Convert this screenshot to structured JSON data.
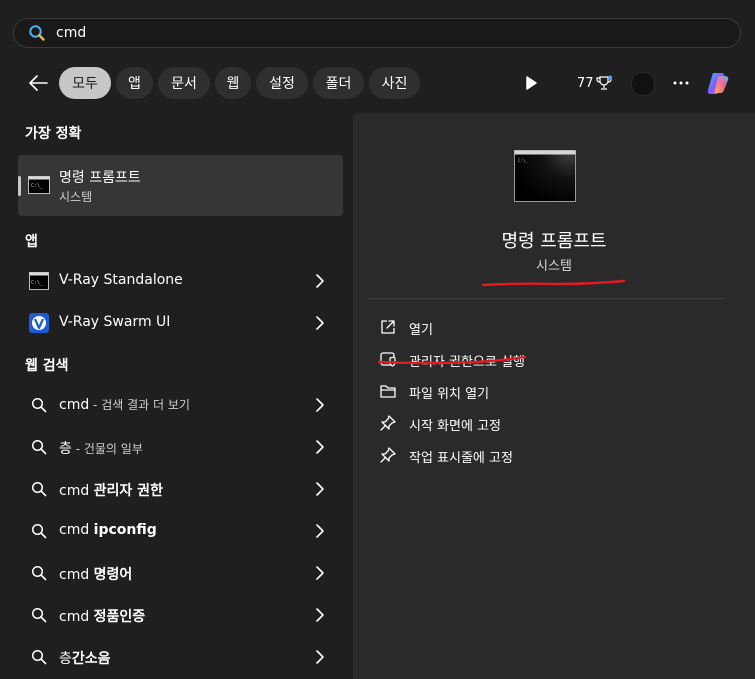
{
  "search": {
    "value": "cmd"
  },
  "filters": [
    "모두",
    "앱",
    "문서",
    "웹",
    "설정",
    "폴더",
    "사진"
  ],
  "toolbar": {
    "points": "77"
  },
  "left": {
    "best_match_heading": "가장 정확",
    "best_match": {
      "title": "명령 프롬프트",
      "subtitle": "시스템"
    },
    "apps_heading": "앱",
    "apps": [
      {
        "label": "V-Ray Standalone"
      },
      {
        "label": "V-Ray Swarm UI"
      }
    ],
    "web_heading": "웹 검색",
    "web": [
      {
        "main": "cmd",
        "suffix": " - 검색 결과 더 보기"
      },
      {
        "main": "층",
        "suffix": " - 건물의 일부"
      },
      {
        "pre": "cmd ",
        "bold": "관리자 권한"
      },
      {
        "pre": "cmd ",
        "bold": "ipconfig"
      },
      {
        "pre": "cmd ",
        "bold": "명령어"
      },
      {
        "pre": "cmd ",
        "bold": "정품인증"
      },
      {
        "pre": "층",
        "bold": "간소음"
      }
    ]
  },
  "detail": {
    "title": "명령 프롬프트",
    "subtitle": "시스템",
    "actions": [
      {
        "label": "열기",
        "icon": "open-external-icon"
      },
      {
        "label": "관리자 권한으로 실행",
        "icon": "shield-admin-icon"
      },
      {
        "label": "파일 위치 열기",
        "icon": "folder-icon"
      },
      {
        "label": "시작 화면에 고정",
        "icon": "pin-icon"
      },
      {
        "label": "작업 표시줄에 고정",
        "icon": "pin-icon"
      }
    ]
  },
  "colors": {
    "underline": "#e01b24",
    "panel": "#2a2a2a",
    "background": "#1f1f1f"
  }
}
